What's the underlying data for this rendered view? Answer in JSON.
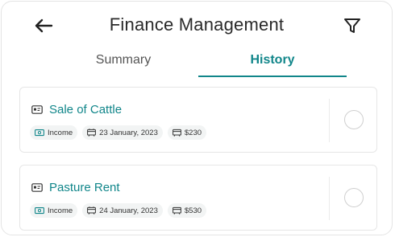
{
  "header": {
    "title": "Finance Management"
  },
  "tabs": [
    {
      "label": "Summary"
    },
    {
      "label": "History"
    }
  ],
  "colors": {
    "accent": "#11868a"
  },
  "records": [
    {
      "name": "Sale of Cattle",
      "type": "Income",
      "date": "23 January, 2023",
      "amount": "$230"
    },
    {
      "name": "Pasture Rent",
      "type": "Income",
      "date": "24 January, 2023",
      "amount": "$530"
    }
  ]
}
